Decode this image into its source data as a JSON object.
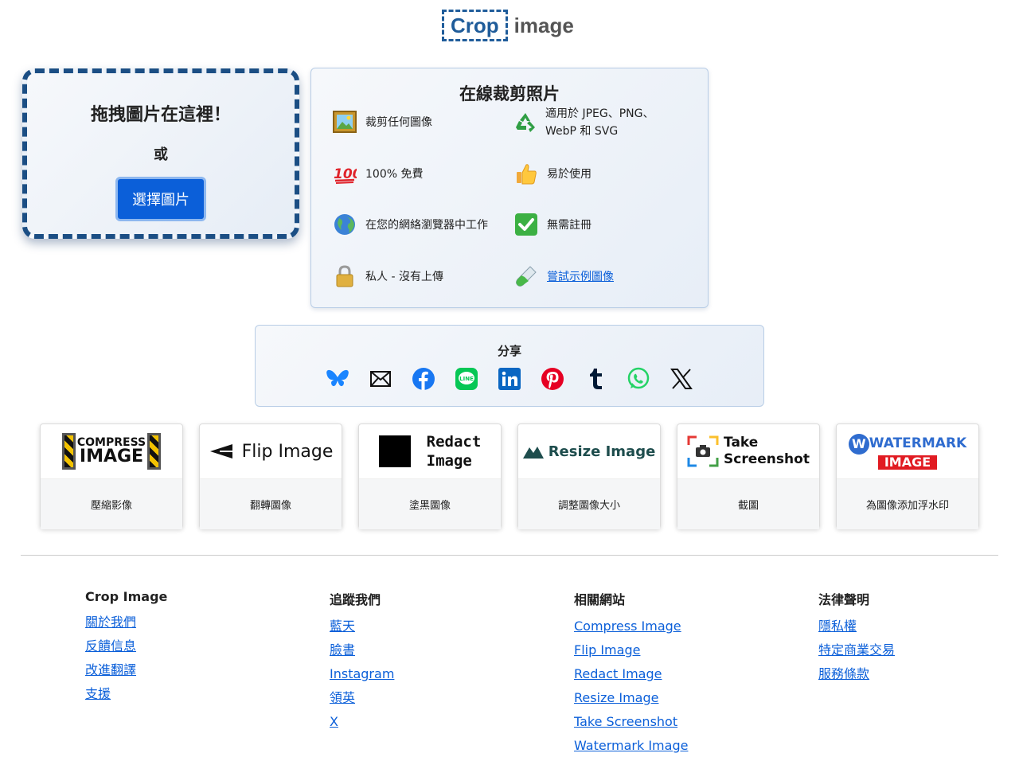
{
  "logo": {
    "crop": "Crop",
    "image": "image"
  },
  "dropzone": {
    "title": "拖拽圖片在這裡！",
    "or": "或",
    "button": "選擇圖片"
  },
  "features": {
    "title": "在線裁剪照片",
    "items": [
      {
        "icon": "framed-picture-icon",
        "text": "裁剪任何圖像"
      },
      {
        "icon": "recycle-icon",
        "text": "適用於 JPEG、PNG、WebP 和 SVG"
      },
      {
        "icon": "hundred-points-icon",
        "text": "100% 免費"
      },
      {
        "icon": "thumbs-up-icon",
        "text": "易於使用"
      },
      {
        "icon": "globe-icon",
        "text": "在您的網絡瀏覽器中工作"
      },
      {
        "icon": "check-mark-icon",
        "text": "無需註冊"
      },
      {
        "icon": "lock-icon",
        "text": "私人 - 沒有上傳"
      },
      {
        "icon": "test-tube-icon",
        "text": "嘗試示例圖像"
      }
    ]
  },
  "share": {
    "title": "分享",
    "icons": [
      "bluesky-icon",
      "email-icon",
      "facebook-icon",
      "line-icon",
      "linkedin-icon",
      "pinterest-icon",
      "tumblr-icon",
      "whatsapp-icon",
      "x-icon"
    ]
  },
  "tools": [
    {
      "logo_line1": "COMPRESS",
      "logo_line2": "IMAGE",
      "label": "壓縮影像"
    },
    {
      "logo_line1": "Flip Image",
      "label": "翻轉圖像"
    },
    {
      "logo_line1": "Redact",
      "logo_line2": "Image",
      "label": "塗黑圖像"
    },
    {
      "logo_line1": "Resize Image",
      "label": "調整圖像大小"
    },
    {
      "logo_line1": "Take",
      "logo_line2": "Screenshot",
      "label": "截圖"
    },
    {
      "logo_line1": "WATERMARK",
      "logo_line2": "IMAGE",
      "label": "為圖像添加浮水印"
    }
  ],
  "footer": {
    "col1": {
      "title": "Crop Image",
      "links": [
        "關於我們",
        "反饋信息",
        "改進翻譯",
        "支援"
      ]
    },
    "col2": {
      "title": "追蹤我們",
      "links": [
        "藍天",
        "臉書",
        "Instagram",
        "領英",
        "X"
      ]
    },
    "col3": {
      "title": "相關網站",
      "links": [
        "Compress Image",
        "Flip Image",
        "Redact Image",
        "Resize Image",
        "Take Screenshot",
        "Watermark Image"
      ]
    },
    "col4": {
      "title": "法律聲明",
      "links": [
        "隱私權",
        "特定商業交易",
        "服務條款"
      ]
    }
  },
  "colors": {
    "accent": "#0b5fd9",
    "border_dark": "#1b4e84"
  }
}
